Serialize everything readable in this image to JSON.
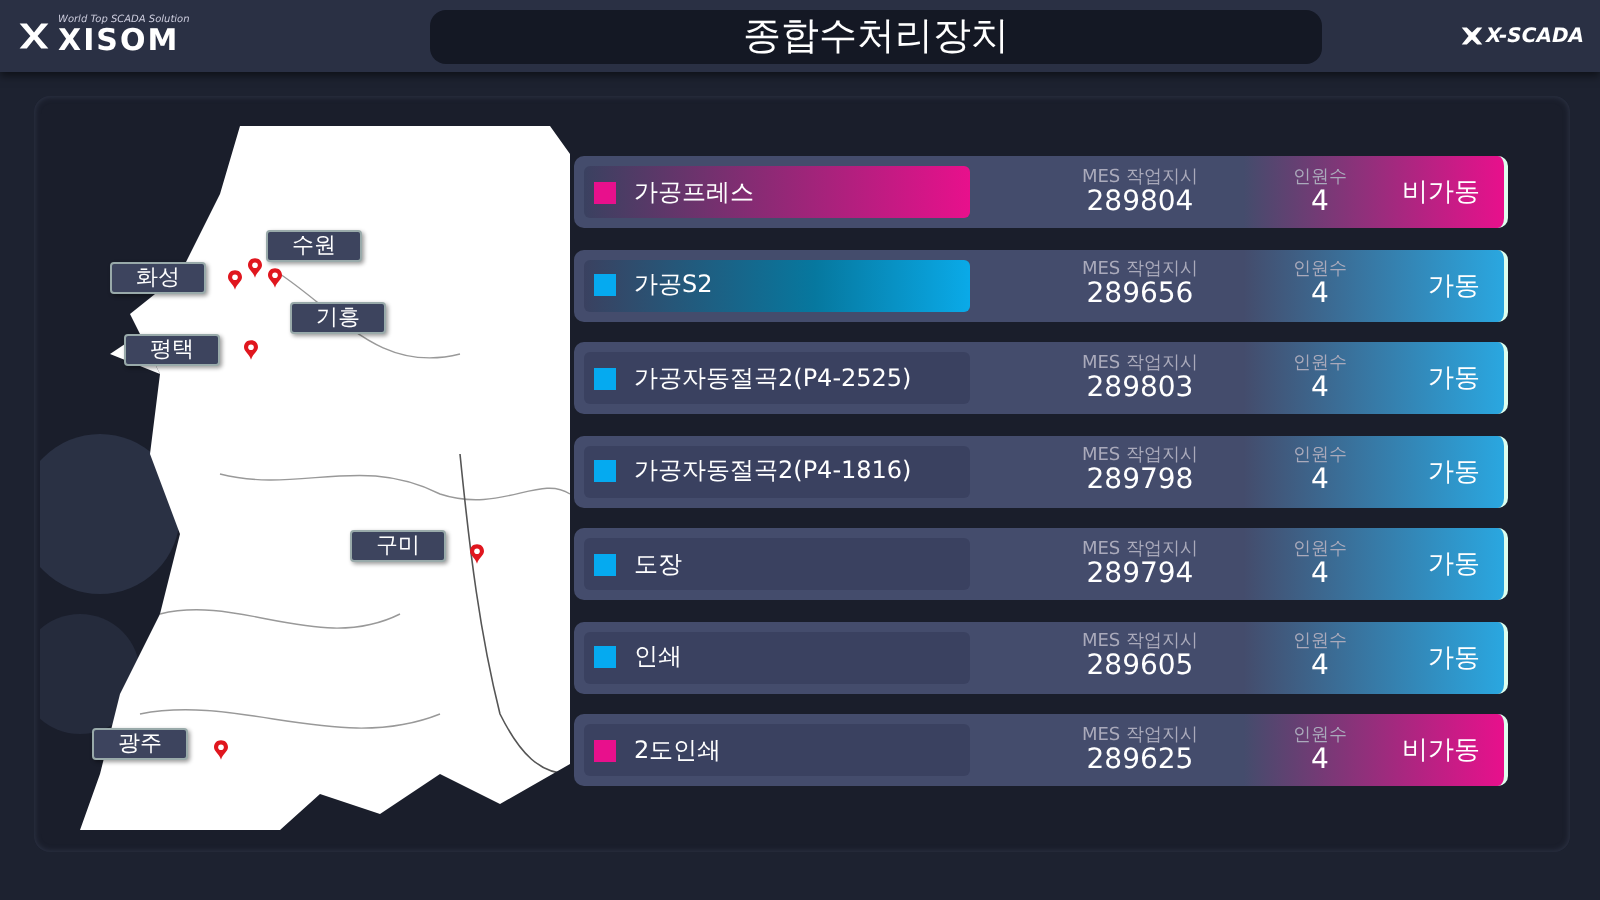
{
  "header": {
    "logo": {
      "name": "XISOM",
      "tagline": "World Top SCADA Solution"
    },
    "title": "종합수처리장치",
    "brand": "X-SCADA"
  },
  "map": {
    "sites": [
      {
        "label": "수원"
      },
      {
        "label": "화성"
      },
      {
        "label": "기흥"
      },
      {
        "label": "평택"
      },
      {
        "label": "구미"
      },
      {
        "label": "광주"
      }
    ]
  },
  "equipment": [
    {
      "name": "가공프레스",
      "highlighted": true,
      "running": false,
      "order_label": "MES 작업지시",
      "order": "289804",
      "workers_label": "인원수",
      "workers": "4",
      "status": "비가동"
    },
    {
      "name": "가공S2",
      "highlighted": true,
      "running": true,
      "order_label": "MES 작업지시",
      "order": "289656",
      "workers_label": "인원수",
      "workers": "4",
      "status": "가동"
    },
    {
      "name": "가공자동절곡2(P4-2525)",
      "highlighted": false,
      "running": true,
      "order_label": "MES 작업지시",
      "order": "289803",
      "workers_label": "인원수",
      "workers": "4",
      "status": "가동"
    },
    {
      "name": "가공자동절곡2(P4-1816)",
      "highlighted": false,
      "running": true,
      "order_label": "MES 작업지시",
      "order": "289798",
      "workers_label": "인원수",
      "workers": "4",
      "status": "가동"
    },
    {
      "name": "도장",
      "highlighted": false,
      "running": true,
      "order_label": "MES 작업지시",
      "order": "289794",
      "workers_label": "인원수",
      "workers": "4",
      "status": "가동"
    },
    {
      "name": "인쇄",
      "highlighted": false,
      "running": true,
      "order_label": "MES 작업지시",
      "order": "289605",
      "workers_label": "인원수",
      "workers": "4",
      "status": "가동"
    },
    {
      "name": "2도인쇄",
      "highlighted": false,
      "running": false,
      "order_label": "MES 작업지시",
      "order": "289625",
      "workers_label": "인원수",
      "workers": "4",
      "status": "비가동"
    }
  ]
}
